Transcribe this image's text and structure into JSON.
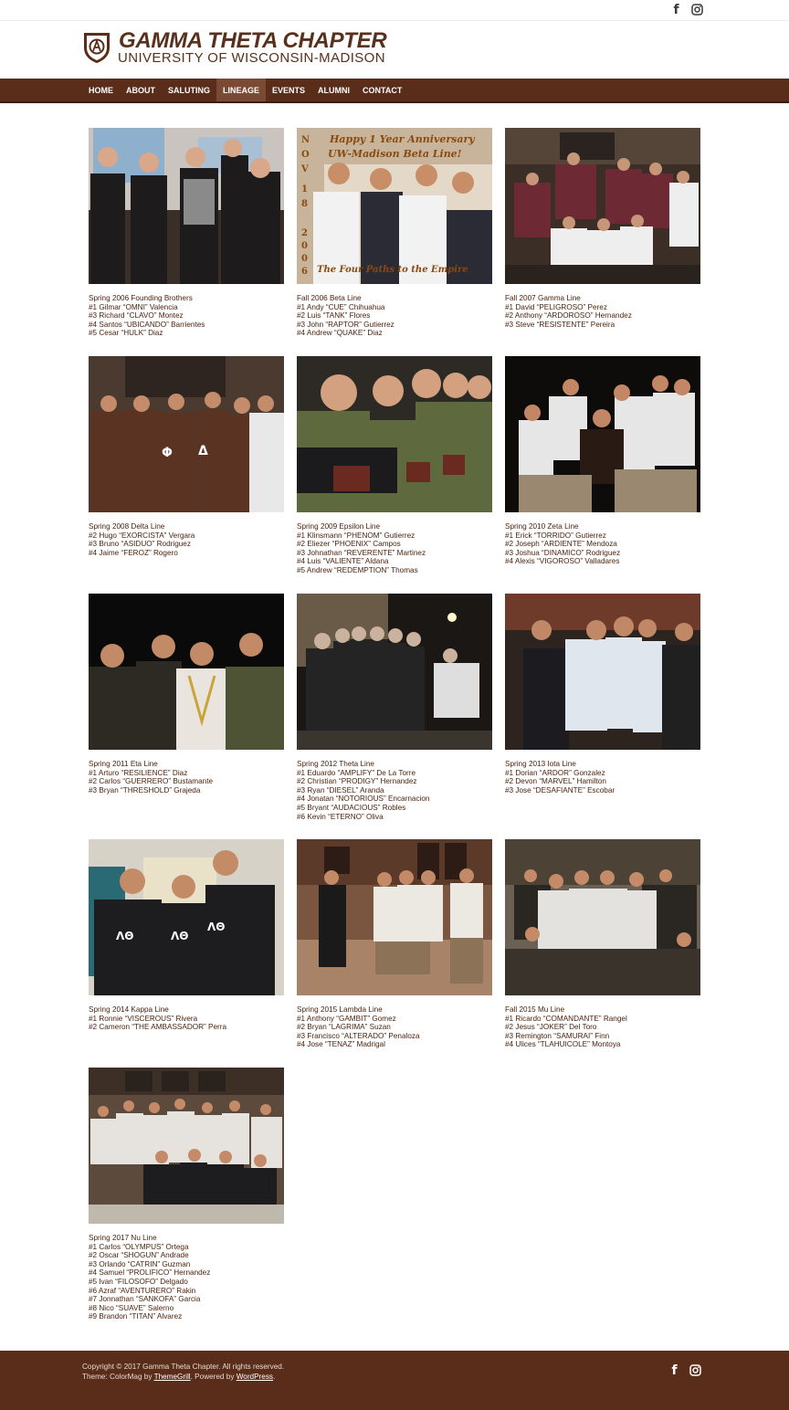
{
  "site": {
    "title": "GAMMA THETA CHAPTER",
    "subtitle": "UNIVERSITY OF WISCONSIN-MADISON"
  },
  "social": {
    "facebook_icon": "f",
    "instagram_icon": "instagram-icon"
  },
  "nav": {
    "items": [
      {
        "label": "HOME"
      },
      {
        "label": "ABOUT"
      },
      {
        "label": "SALUTING"
      },
      {
        "label": "LINEAGE",
        "active": true
      },
      {
        "label": "EVENTS"
      },
      {
        "label": "ALUMNI"
      },
      {
        "label": "CONTACT"
      }
    ]
  },
  "colors": {
    "brand_brown": "#5a2d1b",
    "active_nav": "#7b4a34",
    "text_brown": "#4b220d"
  },
  "photo2_overlay": {
    "headline": "Happy 1 Year Anniversary",
    "subheadline": "UW-Madison Beta Line!",
    "side_text": [
      "N",
      "O",
      "V",
      "1",
      "8",
      "2",
      "0",
      "0",
      "6"
    ],
    "bottom_text": "The Four Paths to the Empire"
  },
  "lines": [
    {
      "title": "Spring 2006 Founding Brothers",
      "members": [
        "#1 Gilmar “OMNI” Valencia",
        "#3 Richard “CLAVO” Montez",
        "#4 Santos “UBICANDO” Barrientes",
        "#5 Cesar “HULK” Diaz"
      ]
    },
    {
      "title": "Fall 2006 Beta Line",
      "members": [
        "#1 Andy “CUE” Chihuahua",
        "#2 Luis “TANK” Flores",
        "#3 John “RAPTOR” Gutierrez",
        "#4 Andrew “QUAKE” Diaz"
      ]
    },
    {
      "title": "Fall 2007 Gamma Line",
      "members": [
        "#1 David “PELIGROSO” Perez",
        "#2 Anthony “ARDOROSO” Hernandez",
        "#3 Steve “RESISTENTE” Pereira"
      ]
    },
    {
      "title": "Spring 2008 Delta Line",
      "members": [
        "#2 Hugo “EXORCISTA” Vergara",
        "#3 Bruno “ASIDUO” Rodriguez",
        "#4 Jaime “FEROZ” Rogero"
      ]
    },
    {
      "title": "Spring 2009 Epsilon Line",
      "members": [
        "#1 Klinsmann “PHENOM” Gutierrez",
        "#2 Eliezer “PHOENIX” Campos",
        "#3 Johnathan “REVERENTE” Martinez",
        "#4 Luis “VALIENTE” Aldana",
        "#5 Andrew “REDEMPTION” Thomas"
      ]
    },
    {
      "title": "Spring 2010 Zeta Line",
      "members": [
        "#1 Erick “TORRIDO” Gutierrez",
        "#2 Joseph “ARDIENTE” Mendoza",
        "#3 Joshua “DINAMICO” Rodriguez",
        "#4 Alexis “VIGOROSO” Valladares"
      ]
    },
    {
      "title": "Spring 2011 Eta Line",
      "members": [
        "#1 Arturo “RESILIENCE” Diaz",
        "#2 Carlos “GUERRERO” Bustamante",
        "#3 Bryan “THRESHOLD” Grajeda"
      ]
    },
    {
      "title": "Spring 2012 Theta Line",
      "members": [
        "#1 Eduardo “AMPLIFY” De La Torre",
        "#2 Christian “PRODIGY” Hernandez",
        "#3 Ryan “DIESEL” Aranda",
        "#4 Jonatan “NOTORIOUS” Encarnacion",
        "#5 Bryant “AUDACIOUS” Robles",
        "#6 Kevin “ETERNO” Oliva"
      ]
    },
    {
      "title": "Spring 2013 Iota Line",
      "members": [
        "#1 Dorian “ARDOR” Gonzalez",
        "#2 Devon “MARVEL” Hamilton",
        "#3 Jose “DESAFIANTE” Escobar"
      ]
    },
    {
      "title": "Spring 2014 Kappa Line",
      "members": [
        "#1 Ronnie “VISCEROUS” Rivera",
        "#2 Cameron “THE AMBASSADOR” Perra"
      ]
    },
    {
      "title": "Spring 2015 Lambda Line",
      "members": [
        "#1 Anthony “GAMBIT” Gomez",
        "#2 Bryan “LAGRIMA” Suzan",
        "#3 Francisco “ALTERADO” Penaloza",
        "#4 Jose “TENAZ” Madrigal"
      ]
    },
    {
      "title": "Fall 2015 Mu Line",
      "members": [
        "#1 Ricardo “COMANDANTE” Rangel",
        "#2 Jesus “JOKER” Del Toro",
        "#3 Remington “SAMURAI” Finn",
        "#4 Ulices “TLAHUICOLE” Montoya"
      ]
    },
    {
      "title": "Spring 2017 Nu Line",
      "members": [
        "#1 Carlos “OLYMPUS” Ortega",
        "#2 Oscar “SHOGUN” Andrade",
        "#3 Orlando “CATRIN” Guzman",
        "#4 Samuel “PROLIFICO” Hernandez",
        "#5 Ivan “FILOSOFO” Delgado",
        "#6 Azraf “AVENTURERO” Rakin",
        "#7 Jonnathan “SANKOFA” Garcia",
        "#8 Nico “SUAVE” Salerno",
        "#9 Brandon “TITAN” Alvarez"
      ]
    }
  ],
  "footer": {
    "copyright": "Copyright © 2017 Gamma Theta Chapter. All rights reserved.",
    "theme_prefix": "Theme: ColorMag by ",
    "theme_author": "ThemeGrill",
    "powered_prefix": ". Powered by ",
    "powered_link": "WordPress",
    "suffix": "."
  }
}
